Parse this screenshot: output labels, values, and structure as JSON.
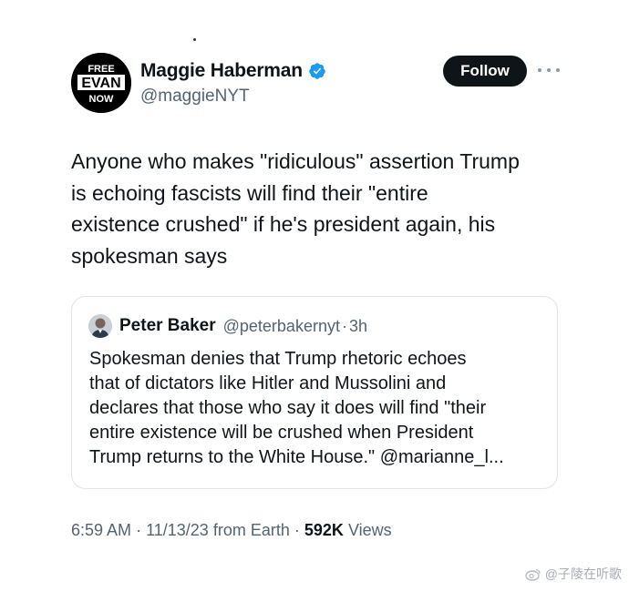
{
  "author": {
    "avatar_text_lines": [
      "FREE",
      "EVAN",
      "NOW"
    ],
    "display_name": "Maggie Haberman",
    "handle": "@maggieNYT",
    "verified_color": "#1d9bf0"
  },
  "actions": {
    "follow_label": "Follow",
    "more_icon": "more-horizontal-icon"
  },
  "tweet": {
    "text_lines": [
      "Anyone who makes \"ridiculous\" assertion Trump",
      "is echoing fascists will find their \"entire",
      "existence crushed\" if he's president again, his",
      "spokesman says"
    ]
  },
  "quote": {
    "author_name": "Peter Baker",
    "author_handle": "@peterbakernyt",
    "separator": "·",
    "time_ago": "3h",
    "text_lines": [
      "Spokesman denies that Trump rhetoric echoes",
      "that of dictators like Hitler and Mussolini and",
      "declares that those who say it does will find \"their",
      "entire existence will be crushed when President",
      "Trump returns to the White House.\" @marianne_l..."
    ]
  },
  "meta": {
    "time": "6:59 AM",
    "separator": "·",
    "date": "11/13/23",
    "source": "from Earth",
    "views_count": "592K",
    "views_label": "Views"
  },
  "watermark": {
    "text": "@子陵在听歌"
  },
  "colors": {
    "text_primary": "#0f1419",
    "text_secondary": "#536471",
    "follow_bg": "#0f1419",
    "border": "#dfe5ea"
  }
}
